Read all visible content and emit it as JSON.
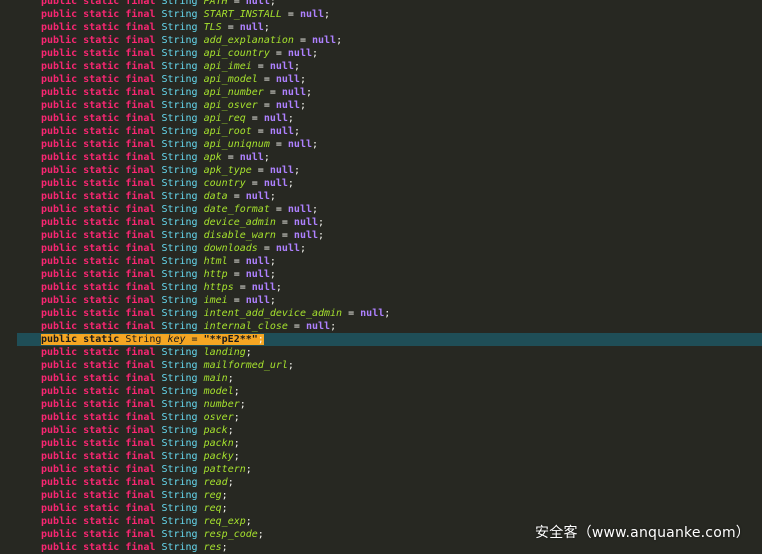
{
  "editor": {
    "modifiers": {
      "public": "public",
      "static": "static",
      "final": "final",
      "type": "String"
    },
    "lines": [
      {
        "name": "PATH",
        "init": "null"
      },
      {
        "name": "START_INSTALL",
        "init": "null"
      },
      {
        "name": "TLS",
        "init": "null"
      },
      {
        "name": "add_explanation",
        "init": "null"
      },
      {
        "name": "api_country",
        "init": "null"
      },
      {
        "name": "api_imei",
        "init": "null"
      },
      {
        "name": "api_model",
        "init": "null"
      },
      {
        "name": "api_number",
        "init": "null"
      },
      {
        "name": "api_osver",
        "init": "null"
      },
      {
        "name": "api_req",
        "init": "null"
      },
      {
        "name": "api_root",
        "init": "null"
      },
      {
        "name": "api_uniqnum",
        "init": "null"
      },
      {
        "name": "apk",
        "init": "null"
      },
      {
        "name": "apk_type",
        "init": "null"
      },
      {
        "name": "country",
        "init": "null"
      },
      {
        "name": "data",
        "init": "null"
      },
      {
        "name": "date_format",
        "init": "null"
      },
      {
        "name": "device_admin",
        "init": "null"
      },
      {
        "name": "disable_warn",
        "init": "null"
      },
      {
        "name": "downloads",
        "init": "null"
      },
      {
        "name": "html",
        "init": "null"
      },
      {
        "name": "http",
        "init": "null"
      },
      {
        "name": "https",
        "init": "null"
      },
      {
        "name": "imei",
        "init": "null"
      },
      {
        "name": "intent_add_device_admin",
        "init": "null"
      },
      {
        "name": "internal_close",
        "init": "null"
      },
      {
        "name": "key",
        "init": "\"**pE2**\"",
        "highlight": true
      },
      {
        "name": "landing"
      },
      {
        "name": "mailformed_url"
      },
      {
        "name": "main"
      },
      {
        "name": "model"
      },
      {
        "name": "number"
      },
      {
        "name": "osver"
      },
      {
        "name": "pack"
      },
      {
        "name": "packn"
      },
      {
        "name": "packy"
      },
      {
        "name": "pattern"
      },
      {
        "name": "read"
      },
      {
        "name": "reg"
      },
      {
        "name": "req"
      },
      {
        "name": "req_exp"
      },
      {
        "name": "resp_code"
      },
      {
        "name": "res"
      }
    ]
  },
  "watermark": {
    "text": "安全客（www.anquanke.com）"
  },
  "colors": {
    "background": "#272822",
    "keyword": "#f92672",
    "type": "#66d9ef",
    "identifier": "#a6e22e",
    "literal": "#ae81ff",
    "current_line": "#1f4e57",
    "selection": "#f5a623"
  }
}
